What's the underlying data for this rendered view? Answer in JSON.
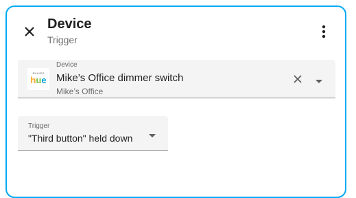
{
  "header": {
    "title": "Device",
    "subtitle": "Trigger"
  },
  "device_picker": {
    "label": "Device",
    "value": "Mike’s Office dimmer switch",
    "area": "Mike’s Office",
    "logo_text_small": "PHILIPS",
    "logo_text": {
      "h": "h",
      "u": "u",
      "e": "e"
    }
  },
  "trigger_select": {
    "label": "Trigger",
    "value": "\"Third button\" held down"
  },
  "colors": {
    "accent_border": "#03a9f4",
    "field_background": "#f4f4f4"
  },
  "icons": {
    "close": "close-icon",
    "menu": "more-vertical-icon",
    "clear": "clear-icon",
    "dropdown": "arrow-drop-down-icon",
    "logo": "hue-logo"
  }
}
